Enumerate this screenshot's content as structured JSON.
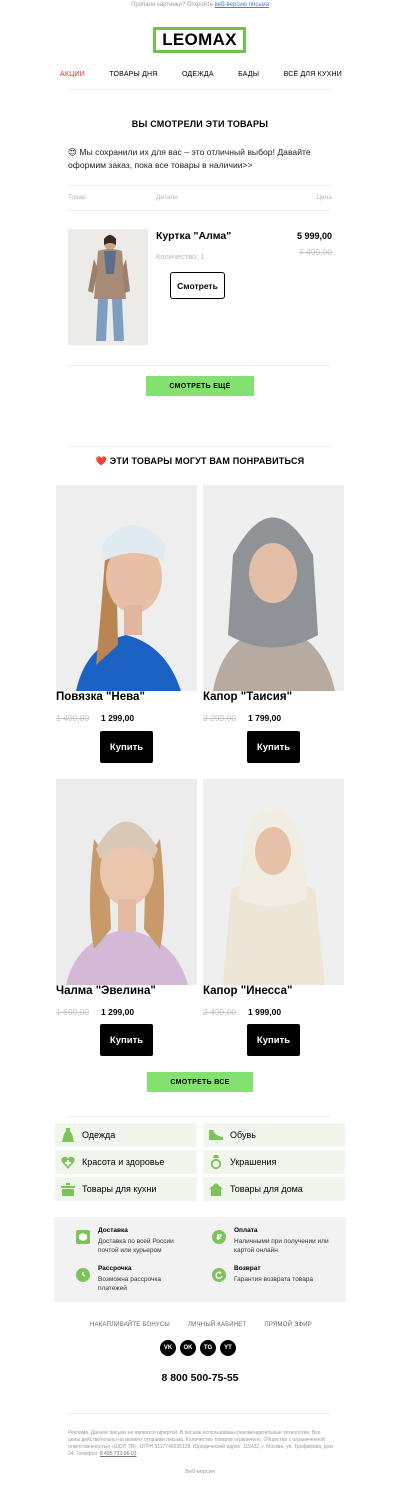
{
  "preheader": {
    "text": "Пропали картинки? Откройте",
    "link": "веб-версию письма"
  },
  "logo": {
    "text": "LEOMAX",
    "color": "#6fc04c"
  },
  "nav": [
    {
      "label": "АКЦИИ",
      "active": true
    },
    {
      "label": "ТОВАРЫ ДНЯ"
    },
    {
      "label": "ОДЕЖДА"
    },
    {
      "label": "БАДЫ"
    },
    {
      "label": "ВСЁ ДЛЯ КУХНИ"
    }
  ],
  "viewed": {
    "title": "ВЫ СМОТРЕЛИ ЭТИ ТОВАРЫ",
    "intro": "😍 Мы сохранили их для вас – это отличный выбор! Давайте оформим заказ, пока все товары в наличии>>",
    "columns": {
      "product": "Товар",
      "details": "Детали",
      "price": "Цена"
    },
    "item": {
      "name": "Куртка \"Алма\"",
      "qty": "Количество: 1",
      "price": "5 999,00",
      "old_price": "7 499,00",
      "button": "Смотреть"
    },
    "more_button": "СМОТРЕТЬ ЕЩЁ"
  },
  "recommended": {
    "title": "❤️ ЭТИ ТОВАРЫ МОГУТ ВАМ ПОНРАВИТЬСЯ",
    "products": [
      {
        "name": "Повязка \"Нева\"",
        "old_price": "1 499,00",
        "price": "1 299,00",
        "button": "Купить"
      },
      {
        "name": "Капор \"Таисия\"",
        "old_price": "2 299,00",
        "price": "1 799,00",
        "button": "Купить"
      },
      {
        "name": "Чалма \"Эвелина\"",
        "old_price": "1 699,00",
        "price": "1 299,00",
        "button": "Купить"
      },
      {
        "name": "Капор \"Инесса\"",
        "old_price": "2 499,00",
        "price": "1 999,00",
        "button": "Купить"
      }
    ],
    "all_button": "СМОТРЕТЬ ВСЕ"
  },
  "categories": [
    {
      "label": "Одежда",
      "icon": "dress-icon"
    },
    {
      "label": "Обувь",
      "icon": "shoe-icon"
    },
    {
      "label": "Красота и здоровье",
      "icon": "heart-plus-icon"
    },
    {
      "label": "Украшения",
      "icon": "ring-icon"
    },
    {
      "label": "Товары для кухни",
      "icon": "pot-icon"
    },
    {
      "label": "Товары для дома",
      "icon": "house-icon"
    }
  ],
  "info": [
    {
      "title": "Доставка",
      "desc": "Доставка по всей России почтой или курьером",
      "icon": "box-icon"
    },
    {
      "title": "Оплата",
      "desc": "Наличными при получении или картой онлайн",
      "icon": "ruble-icon"
    },
    {
      "title": "Рассрочка",
      "desc": "Возможна рассрочка платежей",
      "icon": "clock-icon"
    },
    {
      "title": "Возврат",
      "desc": "Гарантия возврата товара",
      "icon": "return-icon"
    }
  ],
  "footer": {
    "links": [
      "НАКАПЛИВАЙТЕ БОНУСЫ",
      "ЛИЧНЫЙ КАБИНЕТ",
      "ПРЯМОЙ ЭФИР"
    ],
    "socials": [
      "VK",
      "OK",
      "TG",
      "YT"
    ],
    "phone": "8 800 500-75-55",
    "legal": "Реклама. Данное письмо не является офертой. В письме использованы рекомендательные технологии. Все цены действительны на момент отправки письма. Количество товаров ограничено. Общество с ограниченной ответственностью «ШОП ТВ», ОГРН 5117746036128. Юридический адрес: 115432, г. Москва, ул. Трофимова, дом 24. Телефон:",
    "legal_phone": "8 495 733-96-03",
    "web_version": "Веб-версия"
  },
  "accent_colors": {
    "green": "#83e26f",
    "red": "#e0332f",
    "light_green_bg": "#f0f6ec"
  }
}
